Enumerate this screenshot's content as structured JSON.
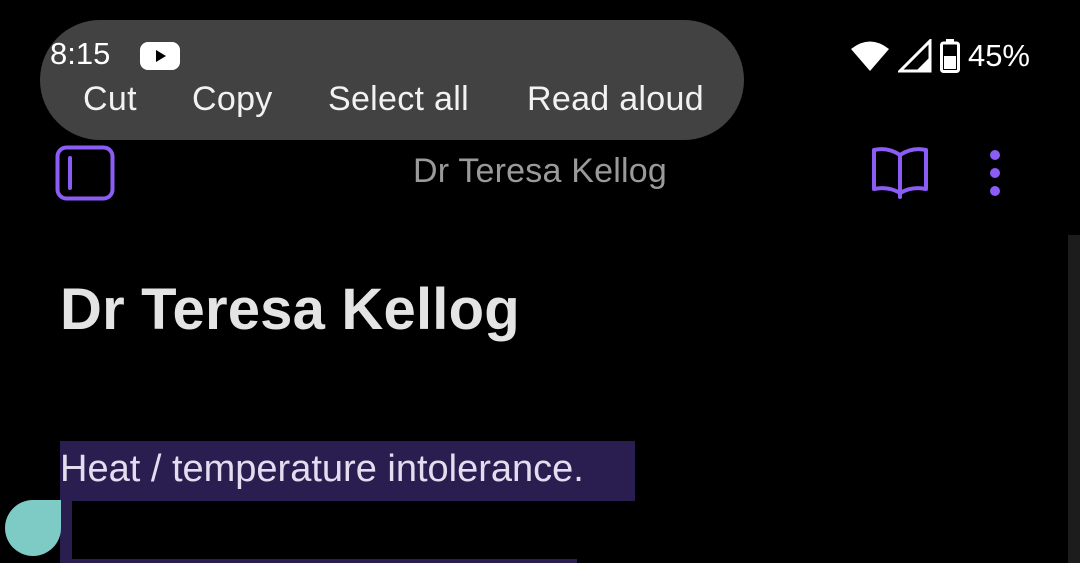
{
  "status_bar": {
    "time": "8:15",
    "battery_percent": "45%",
    "notification_icon": "youtube-icon",
    "icons": [
      "wifi-icon",
      "cellular-signal-icon",
      "battery-icon"
    ]
  },
  "selection_toolbar": {
    "actions": [
      "Cut",
      "Copy",
      "Select all",
      "Read aloud"
    ]
  },
  "app_bar": {
    "title": "Dr Teresa Kellog",
    "left_icon": "sidebar-toggle-icon",
    "right_icons": [
      "reading-mode-icon",
      "more-vert-icon"
    ]
  },
  "note": {
    "title": "Dr Teresa Kellog",
    "lines": [
      "Heat / temperature intolerance. "
    ]
  },
  "colors": {
    "background": "#000000",
    "accent": "#8b5cf6",
    "selection": "#2a1e50",
    "toolbar": "#424242",
    "handle": "#7ecbc5"
  }
}
